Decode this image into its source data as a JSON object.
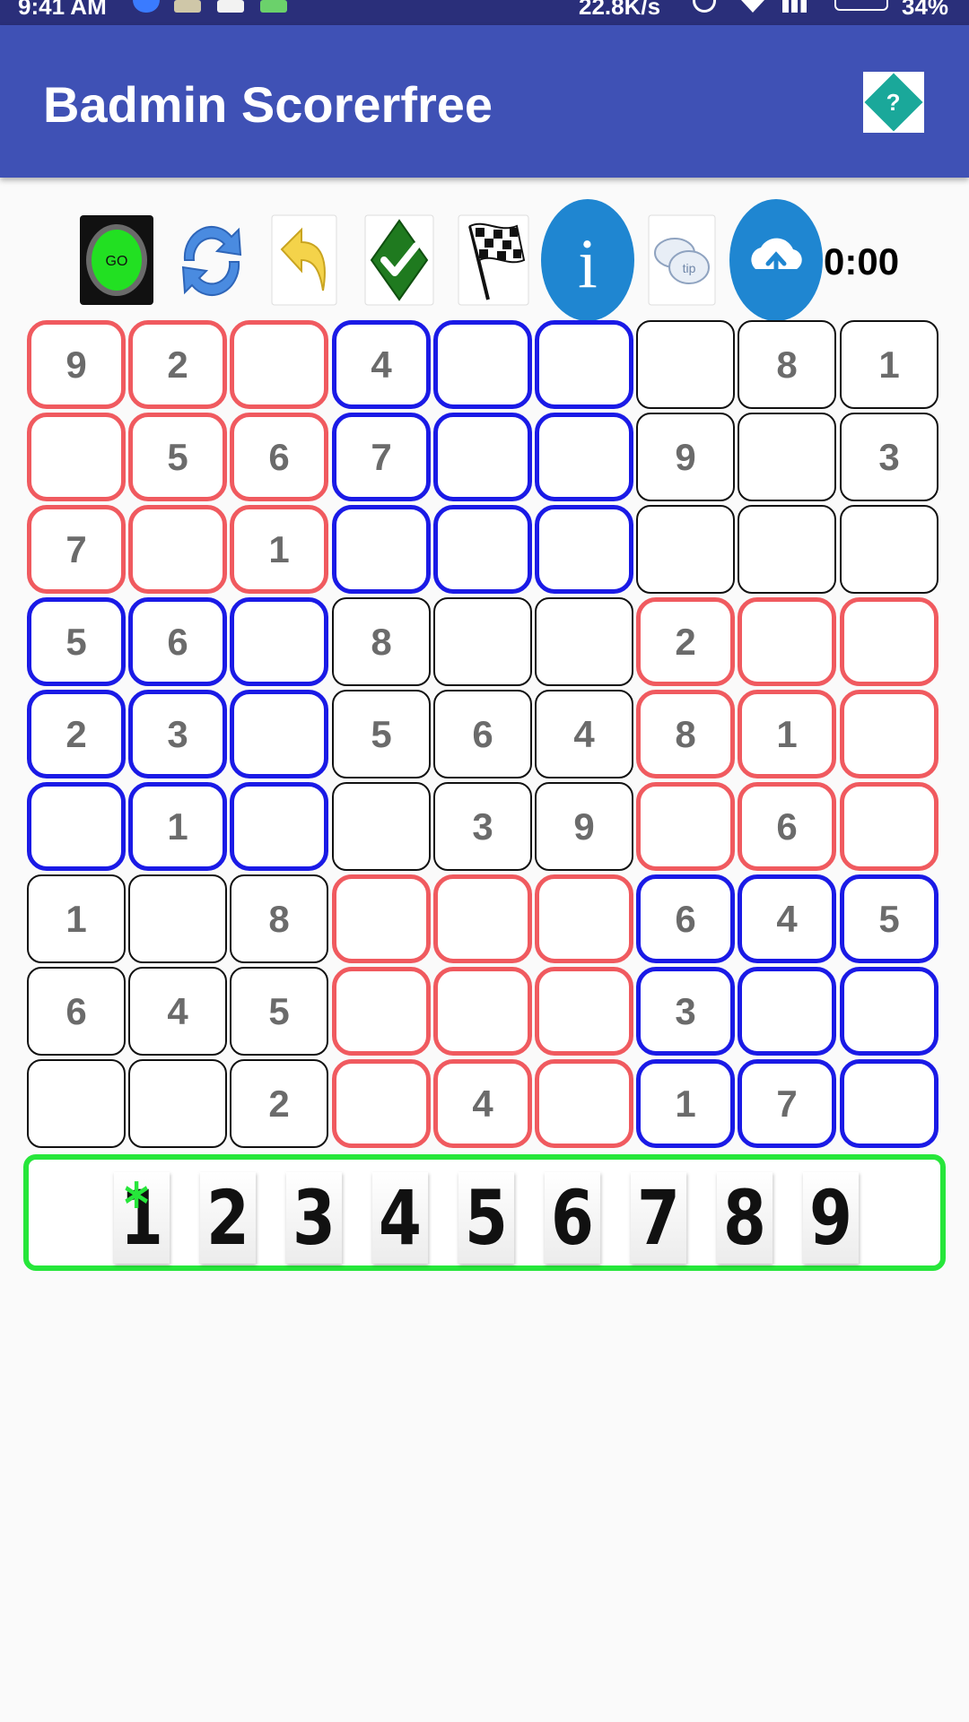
{
  "status_bar": {
    "time": "9:41 AM",
    "speed": "22.8K/s",
    "battery": "34%"
  },
  "app_bar": {
    "title": "Badmin Scorerfree",
    "help_label": "?"
  },
  "toolbar": {
    "go_label": "GO",
    "info_label": "i",
    "tip_label": "tip",
    "timer": "0:00"
  },
  "grid": {
    "rows": [
      [
        "9",
        "2",
        "",
        "4",
        "",
        "",
        "",
        "8",
        "1"
      ],
      [
        "",
        "5",
        "6",
        "7",
        "",
        "",
        "9",
        "",
        "3"
      ],
      [
        "7",
        "",
        "1",
        "",
        "",
        "",
        "",
        "",
        ""
      ],
      [
        "5",
        "6",
        "",
        "8",
        "",
        "",
        "2",
        "",
        ""
      ],
      [
        "2",
        "3",
        "",
        "5",
        "6",
        "4",
        "8",
        "1",
        ""
      ],
      [
        "",
        "1",
        "",
        "",
        "3",
        "9",
        "",
        "6",
        ""
      ],
      [
        "1",
        "",
        "8",
        "",
        "",
        "",
        "6",
        "4",
        "5"
      ],
      [
        "6",
        "4",
        "5",
        "",
        "",
        "",
        "3",
        "",
        ""
      ],
      [
        "",
        "",
        "2",
        "",
        "4",
        "",
        "1",
        "7",
        ""
      ]
    ],
    "box_colors": [
      [
        "red",
        "blue",
        "black"
      ],
      [
        "blue",
        "black",
        "red"
      ],
      [
        "black",
        "red",
        "blue"
      ]
    ]
  },
  "numpad": {
    "keys": [
      "1",
      "2",
      "3",
      "4",
      "5",
      "6",
      "7",
      "8",
      "9"
    ],
    "selected_marker": "*"
  },
  "colors": {
    "app_bar": "#3f51b5",
    "status_bar": "#2a2f7a",
    "red_box": "#f05a5f",
    "blue_box": "#1a1ae6",
    "numpad_border": "#26e63a"
  }
}
